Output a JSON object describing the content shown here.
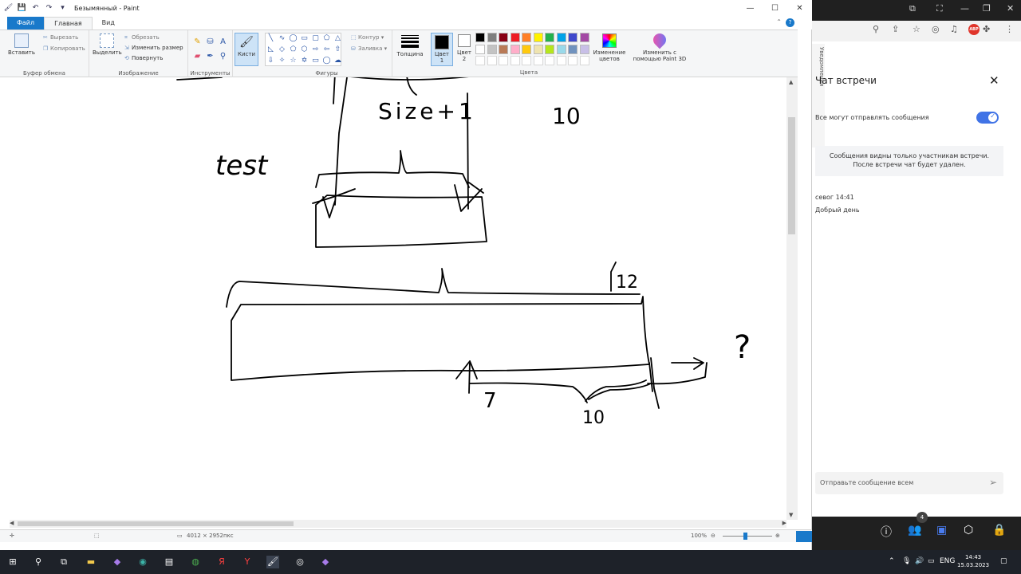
{
  "window": {
    "title": "Безымянный - Paint"
  },
  "menu_tabs": [
    "Файл",
    "Главная",
    "Вид"
  ],
  "ribbon": {
    "clipboard": {
      "paste": "Вставить",
      "cut": "Вырезать",
      "copy": "Копировать",
      "label": "Буфер обмена"
    },
    "image": {
      "select": "Выделить",
      "crop": "Обрезать",
      "resize": "Изменить размер",
      "rotate": "Повернуть",
      "label": "Изображение"
    },
    "tools": {
      "label": "Инструменты"
    },
    "brushes": {
      "label": "Кисти"
    },
    "shapes": {
      "outline": "Контур",
      "fill": "Заливка",
      "label": "Фигуры"
    },
    "size": {
      "label": "Толщина"
    },
    "color1": {
      "label1": "Цвет",
      "label2": "1"
    },
    "color2": {
      "label1": "Цвет",
      "label2": "2"
    },
    "colors": {
      "label": "Цвета",
      "palette": [
        "#000000",
        "#7f7f7f",
        "#880015",
        "#ed1c24",
        "#ff7f27",
        "#fff200",
        "#22b14c",
        "#00a2e8",
        "#3f48cc",
        "#a349a4",
        "#ffffff",
        "#c3c3c3",
        "#b97a57",
        "#ffaec9",
        "#ffc90e",
        "#efe4b0",
        "#b5e61d",
        "#99d9ea",
        "#7092be",
        "#c8bfe7"
      ]
    },
    "edit_colors": {
      "line1": "Изменение",
      "line2": "цветов"
    },
    "paint3d": {
      "line1": "Изменить с",
      "line2": "помощью Paint 3D"
    }
  },
  "canvas_text": {
    "size": "Size+1",
    "ten_a": "10",
    "test": "test",
    "twelve": "12",
    "seven": "7",
    "ten_b": "10",
    "question": "?"
  },
  "status": {
    "dimensions": "4012 × 2952пкс",
    "zoom": "100%"
  },
  "teams": {
    "notifications": "Уведомления",
    "title": "Чат встречи",
    "toggle_label": "Все могут отправлять сообщения",
    "info_line1": "Сообщения видны только участникам встречи.",
    "info_line2": "После встречи чат будет удален.",
    "msg_meta": "севог  14:41",
    "msg_text": "Добрый день",
    "input_placeholder": "Отправьте сообщение всем",
    "participants_count": "4"
  },
  "taskbar": {
    "lang": "ENG",
    "time": "14:43",
    "date": "15.03.2023"
  }
}
